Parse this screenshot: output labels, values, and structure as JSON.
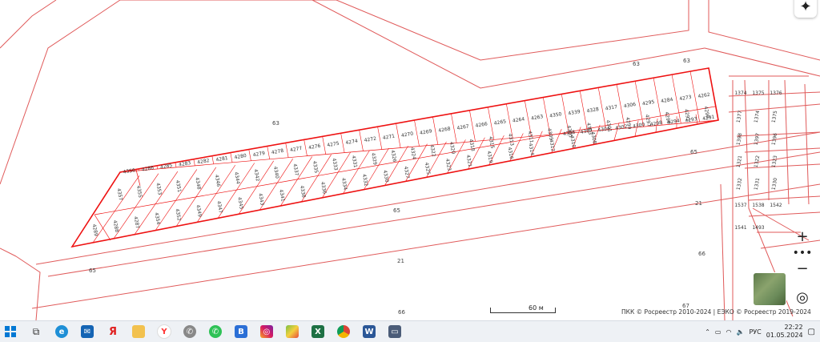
{
  "map": {
    "plots_top": [
      "4356",
      "4286",
      "4285",
      "4283",
      "4282",
      "4281",
      "4280",
      "4279",
      "4278",
      "4277",
      "4276",
      "4275",
      "4274",
      "4272",
      "4271",
      "4270",
      "4269",
      "4268",
      "4267",
      "4266",
      "4265",
      "4264",
      "4263",
      "4350",
      "4339",
      "4328",
      "4317",
      "4306",
      "4295",
      "4284",
      "4273",
      "4262"
    ],
    "plots_mid": [
      "4358",
      "4307",
      "4304",
      "4302",
      "4300",
      "4298",
      "4294",
      "4293",
      "4291"
    ],
    "plots_lower": [
      "4357",
      "4355",
      "4353",
      "4351",
      "4348",
      "4346",
      "4344",
      "4342",
      "4340",
      "4337",
      "4335",
      "4333",
      "4331",
      "4329",
      "4326",
      "4324",
      "4322",
      "4320",
      "4318",
      "4315",
      "4313",
      "4311",
      "4309",
      "4305",
      "4303",
      "4301",
      "4299",
      "4297",
      "4296",
      "4292",
      "4290"
    ],
    "plots_bottom": [
      "4289",
      "4288",
      "4287",
      "4354",
      "4352",
      "4349",
      "4347",
      "4345",
      "4343",
      "4341",
      "4338",
      "4336",
      "4334",
      "4332",
      "4330",
      "4327",
      "4325",
      "4323",
      "4321",
      "4319",
      "4316",
      "4314",
      "4312",
      "4310",
      "4308"
    ],
    "right_plots": [
      "1374",
      "1375",
      "1376",
      "1377",
      "1374",
      "1375",
      "1398",
      "1397",
      "1396",
      "1321",
      "1322",
      "1323",
      "1332",
      "1331",
      "1330",
      "1537",
      "1538",
      "1542",
      "1541",
      "1493"
    ],
    "region_labels": {
      "r63a": "63",
      "r63b": "63",
      "r63c": "63",
      "r65a": "65",
      "r65b": "65",
      "r65c": "65",
      "r21a": "21",
      "r21b": "21",
      "r66a": "66",
      "r66b": "66",
      "r67": "67"
    }
  },
  "controls": {
    "compass": "✦",
    "zoom_in": "+",
    "more": "•••",
    "zoom_out": "−",
    "geolocate": "◎",
    "scale": "60 м"
  },
  "copyright": "ПКК © Росреестр 2010-2024 | ЕЭКО © Росреестр 2019-2024",
  "taskbar": {
    "lang": "РУС",
    "time": "22:22",
    "date": "01.05.2024",
    "apps": [
      "windows-icon",
      "task-view-icon",
      "edge-icon",
      "mail-icon",
      "yandex-icon",
      "explorer-icon",
      "yandex-browser-icon",
      "whatsapp-gray-icon",
      "whatsapp-icon",
      "b-app-icon",
      "instagram-icon",
      "paint-icon",
      "excel-icon",
      "chrome-icon",
      "word-icon",
      "monitor-icon"
    ]
  }
}
